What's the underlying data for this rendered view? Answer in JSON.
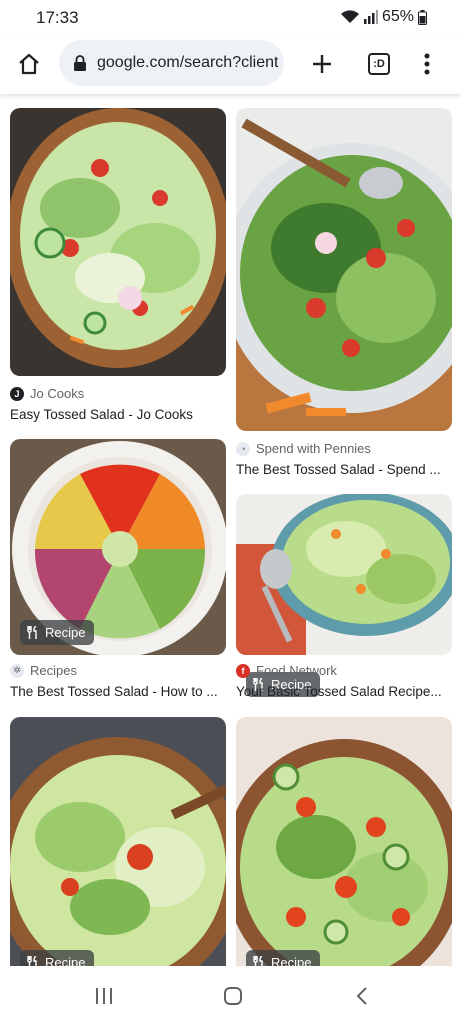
{
  "status_bar": {
    "time": "17:33",
    "battery": "65%",
    "icons": [
      "wifi-icon",
      "signal-icon",
      "battery-icon"
    ]
  },
  "toolbar": {
    "url": "google.com/search?client",
    "tab_count": ":D",
    "icons": [
      "home-icon",
      "lock-icon",
      "plus-icon",
      "tab-switcher-icon",
      "more-vert-icon"
    ]
  },
  "results": [
    {
      "source": "Jo Cooks",
      "title": "Easy Tossed Salad - Jo Cooks",
      "badge": ""
    },
    {
      "source": "Spend with Pennies",
      "title": "The Best Tossed Salad - Spend ...",
      "badge": ""
    },
    {
      "source": "Recipes",
      "title": "The Best Tossed Salad - How to ...",
      "badge": "Recipe"
    },
    {
      "source": "Food Network",
      "title": "Your Basic Tossed Salad Recipe...",
      "badge": "Recipe"
    },
    {
      "source": "",
      "title": "",
      "badge": "Recipe"
    },
    {
      "source": "",
      "title": "",
      "badge": "Recipe"
    }
  ],
  "navbar": {
    "icons": [
      "recents-icon",
      "home-nav-icon",
      "back-icon"
    ]
  }
}
